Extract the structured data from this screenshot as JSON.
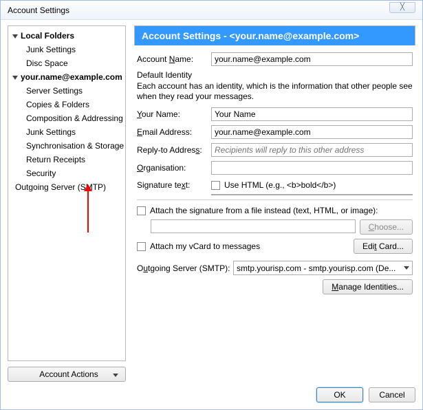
{
  "window": {
    "title": "Account Settings",
    "close_glyph": "╳"
  },
  "sidebar": {
    "local_folders": "Local Folders",
    "junk_settings": "Junk Settings",
    "disc_space": "Disc Space",
    "account_email": "your.name@example.com",
    "server_settings": "Server Settings",
    "copies_folders": "Copies & Folders",
    "composition": "Composition & Addressing",
    "junk_settings2": "Junk Settings",
    "sync_storage": "Synchronisation & Storage",
    "return_receipts": "Return Receipts",
    "security": "Security",
    "outgoing_smtp": "Outgoing Server (SMTP)"
  },
  "panel": {
    "title": "Account Settings - <your.name@example.com>"
  },
  "form": {
    "account_name_label_pre": "Account ",
    "account_name_label_ul": "N",
    "account_name_label_post": "ame:",
    "account_name_value": "your.name@example.com",
    "default_identity": "Default Identity",
    "identity_desc": "Each account has an identity, which is the information that other people see when they read your messages.",
    "your_name_ul": "Y",
    "your_name_post": "our Name:",
    "your_name_value": "Your Name",
    "email_ul": "E",
    "email_post": "mail Address:",
    "email_value": "your.name@example.com",
    "reply_label": "Reply-to Addres",
    "reply_ul": "s",
    "reply_label_post": ":",
    "reply_placeholder": "Recipients will reply to this other address",
    "org_ul": "O",
    "org_post": "rganisation:",
    "sig_label": "Signature te",
    "sig_ul": "x",
    "sig_label_post": "t:",
    "use_html_pre": "Use ",
    "use_html_ul": "H",
    "use_html_post": "TML (e.g., <b>bold</b>)",
    "attach_sig_pre": "Attach the signature from a file instead (te",
    "attach_sig_ul": "x",
    "attach_sig_post2": "t, HTML, or image):",
    "attach_sig": "Attach the signature from a file instead (text, HTML, or image):",
    "choose_ul": "C",
    "choose_post": "hoose...",
    "vcard_pre": "Attach my ",
    "vcard_ul": "v",
    "vcard_post": "Card to messages",
    "edit_card_pre": "Edi",
    "edit_card_ul": "t",
    "edit_card_post": " Card...",
    "smtp_pre": "O",
    "smtp_ul": "u",
    "smtp_post": "tgoing Server (SMTP):",
    "smtp_value": "smtp.yourisp.com - smtp.yourisp.com (De...",
    "manage_ul": "M",
    "manage_post": "anage Identities..."
  },
  "footer": {
    "account_actions_ul": "A",
    "account_actions_post": "ccount Actions",
    "ok": "OK",
    "cancel": "Cancel"
  }
}
